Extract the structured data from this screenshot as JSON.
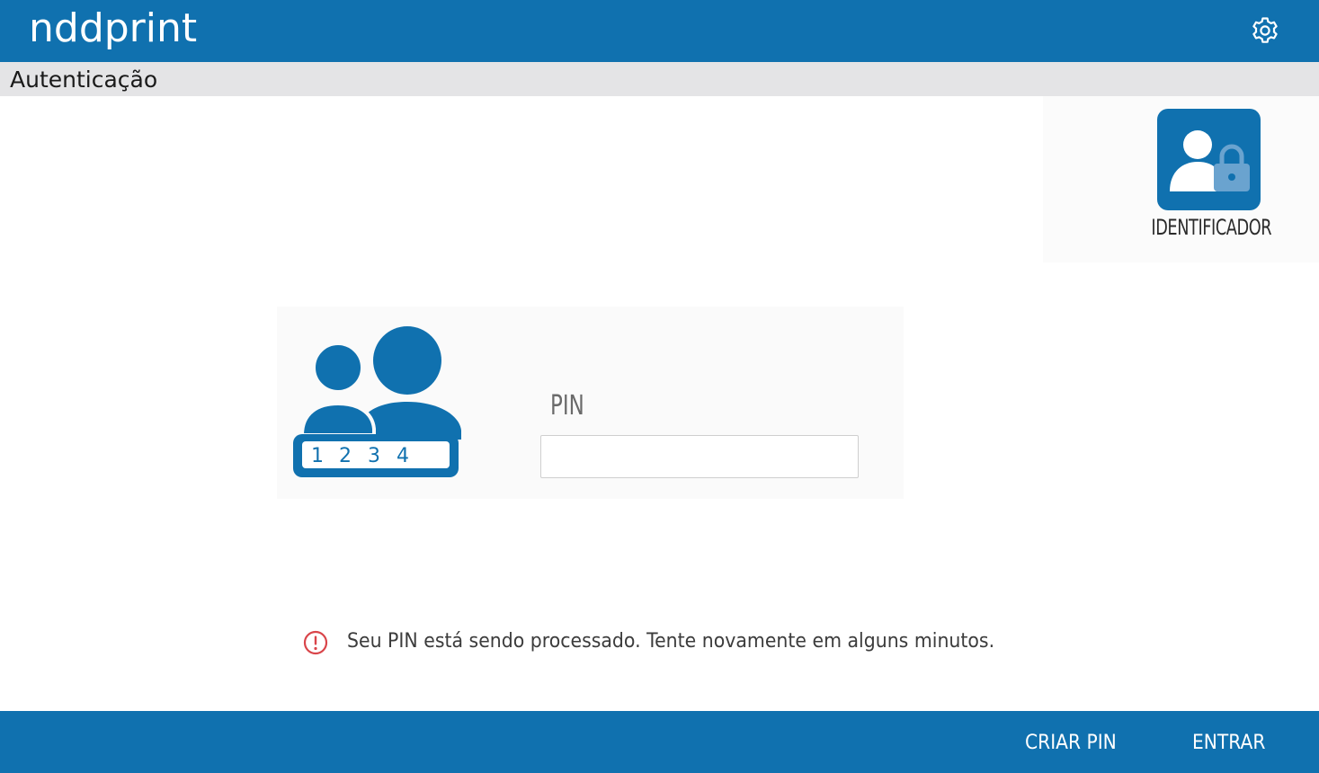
{
  "header": {
    "logo_text": "nddprint",
    "settings_icon": "gear-icon"
  },
  "titlebar": {
    "title": "Autenticação"
  },
  "identifier": {
    "icon": "user-lock-icon",
    "label": "IDENTIFICADOR"
  },
  "pin": {
    "illustration_icon": "users-pin-icon",
    "illustration_digits": [
      "1",
      "2",
      "3",
      "4"
    ],
    "label": "PIN",
    "value": "",
    "placeholder": ""
  },
  "message": {
    "icon": "error-icon",
    "text": "Seu PIN está sendo processado. Tente novamente em alguns minutos."
  },
  "footer": {
    "create_pin_label": "CRIAR PIN",
    "enter_label": "ENTRAR"
  },
  "colors": {
    "brand_blue": "#1071af",
    "titlebar_gray": "#e4e4e6",
    "error_red": "#d9454a"
  }
}
